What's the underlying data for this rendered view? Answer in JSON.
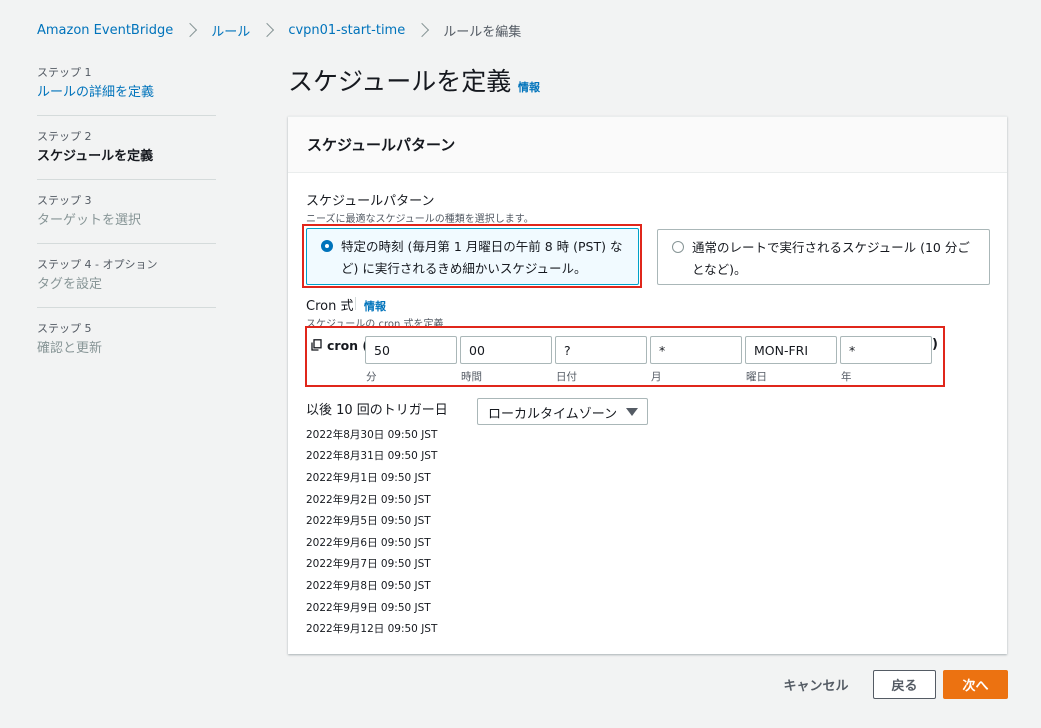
{
  "breadcrumb": {
    "items": [
      "Amazon EventBridge",
      "ルール",
      "cvpn01-start-time"
    ],
    "current": "ルールを編集"
  },
  "nav": {
    "steps": [
      {
        "label": "ステップ 1",
        "title": "ルールの詳細を定義"
      },
      {
        "label": "ステップ 2",
        "title": "スケジュールを定義"
      },
      {
        "label": "ステップ 3",
        "title": "ターゲットを選択"
      },
      {
        "label": "ステップ 4 - オプション",
        "title": "タグを設定"
      },
      {
        "label": "ステップ 5",
        "title": "確認と更新"
      }
    ]
  },
  "page": {
    "title": "スケジュールを定義",
    "info": "情報"
  },
  "panel": {
    "title": "スケジュールパターン",
    "pattern_label": "スケジュールパターン",
    "pattern_desc": "ニーズに最適なスケジュールの種類を選択します。",
    "option1_line1": "特定の時刻 (毎月第 1 月曜日の午前 8 時 (PST) な",
    "option1_line2": "ど) に実行されるきめ細かいスケジュール。",
    "option2_line1": "通常のレートで実行されるスケジュール (10 分ご",
    "option2_line2": "となど)。",
    "cron_label": "Cron 式",
    "cron_info": "情報",
    "cron_desc": "スケジュールの cron 式を定義",
    "cron_prefix": "cron (",
    "cron_suffix": ")",
    "cron_fields": [
      {
        "value": "50",
        "label": "分"
      },
      {
        "value": "00",
        "label": "時間"
      },
      {
        "value": "?",
        "label": "日付"
      },
      {
        "value": "*",
        "label": "月"
      },
      {
        "value": "MON-FRI",
        "label": "曜日"
      },
      {
        "value": "*",
        "label": "年"
      }
    ],
    "triggers_label": "以後 10 回のトリガー日",
    "timezone_selected": "ローカルタイムゾーン",
    "trigger_dates": [
      "2022年8月30日 09:50 JST",
      "2022年8月31日 09:50 JST",
      "2022年9月1日 09:50 JST",
      "2022年9月2日 09:50 JST",
      "2022年9月5日 09:50 JST",
      "2022年9月6日 09:50 JST",
      "2022年9月7日 09:50 JST",
      "2022年9月8日 09:50 JST",
      "2022年9月9日 09:50 JST",
      "2022年9月12日 09:50 JST"
    ]
  },
  "footer": {
    "cancel": "キャンセル",
    "back": "戻る",
    "next": "次へ"
  },
  "colors": {
    "accent": "#0073bb",
    "primary_button": "#ec7211",
    "highlight": "#e0261b"
  }
}
